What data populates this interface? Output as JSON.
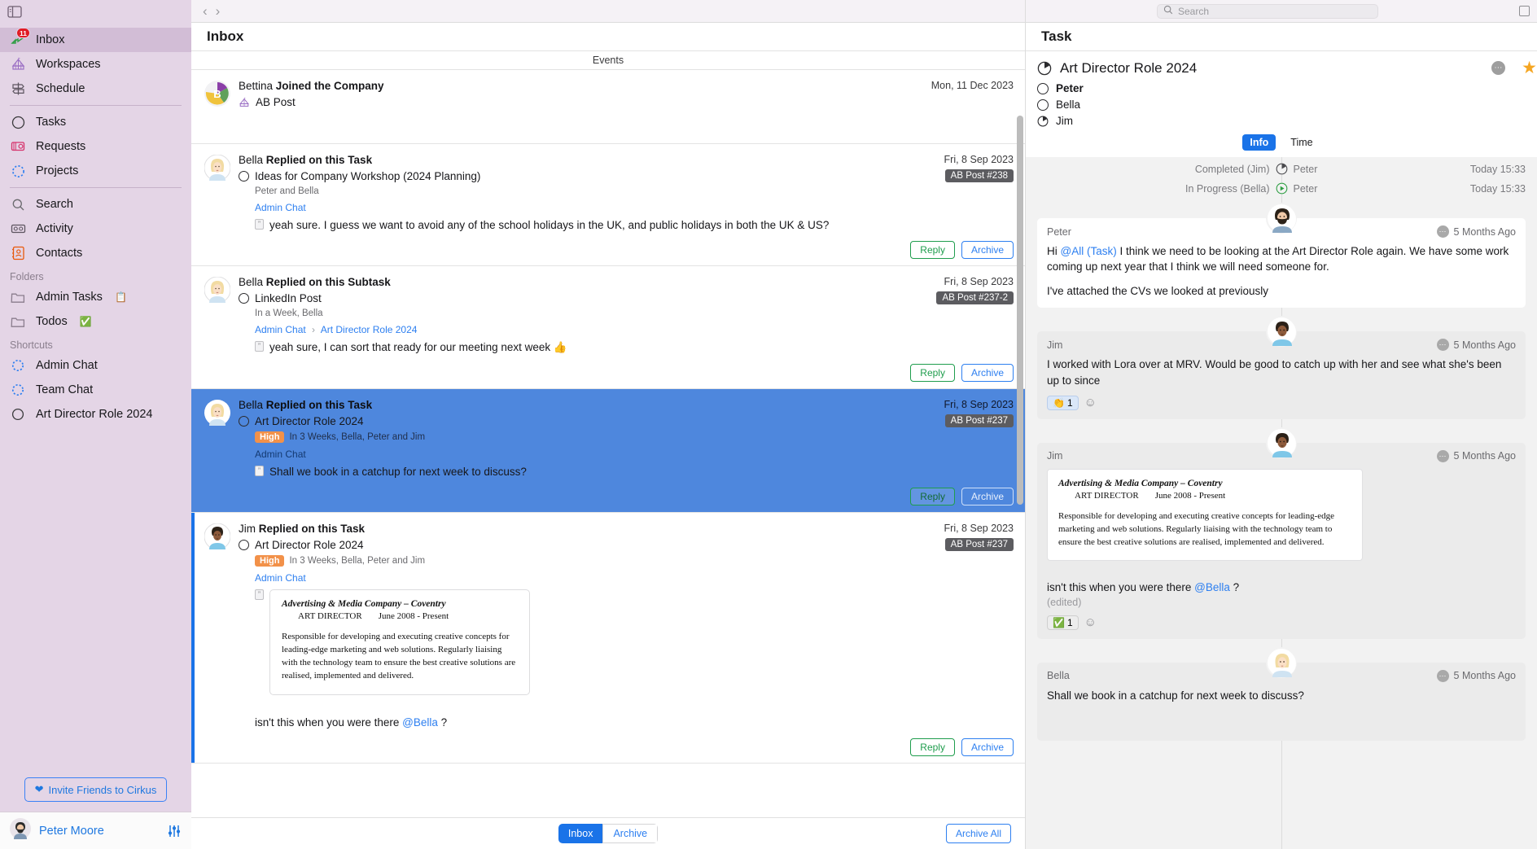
{
  "sidebar": {
    "panel_toggle": "panel-toggle",
    "items": [
      {
        "label": "Inbox",
        "icon": "inbox-icon",
        "badge": "11",
        "active": true
      },
      {
        "label": "Workspaces",
        "icon": "workspaces-icon"
      },
      {
        "label": "Schedule",
        "icon": "schedule-icon"
      }
    ],
    "items2": [
      {
        "label": "Tasks",
        "icon": "tasks-circle-icon"
      },
      {
        "label": "Requests",
        "icon": "requests-icon"
      },
      {
        "label": "Projects",
        "icon": "projects-dotted-circle-icon"
      }
    ],
    "items3": [
      {
        "label": "Search",
        "icon": "search-icon"
      },
      {
        "label": "Activity",
        "icon": "activity-icon"
      },
      {
        "label": "Contacts",
        "icon": "contacts-icon"
      }
    ],
    "folders_heading": "Folders",
    "folders": [
      {
        "label": "Admin Tasks",
        "emoji": "📋",
        "icon": "folder-icon"
      },
      {
        "label": "Todos",
        "emoji": "✅",
        "icon": "folder-icon"
      }
    ],
    "shortcuts_heading": "Shortcuts",
    "shortcuts": [
      {
        "label": "Admin Chat",
        "icon": "dotted-circle-icon"
      },
      {
        "label": "Team Chat",
        "icon": "dotted-circle-icon"
      },
      {
        "label": "Art Director Role 2024",
        "icon": "circle-icon"
      }
    ],
    "invite_label": "Invite Friends to Cirkus",
    "user_name": "Peter Moore"
  },
  "center": {
    "back_arrow": "‹",
    "forward_arrow": "›",
    "title": "Inbox",
    "events_label": "Events",
    "rows": [
      {
        "who_name": "Bettina",
        "who_action": "Joined the Company",
        "date": "Mon, 11 Dec 2023",
        "workspace": "AB Post",
        "kind": "event"
      },
      {
        "who_name": "Bella",
        "who_action": "Replied on this Task",
        "date": "Fri, 8 Sep 2023",
        "task": "Ideas for Company Workshop (2024 Planning)",
        "tag": "AB Post #238",
        "meta": "Peter and Bella",
        "channel": "Admin Chat",
        "message": "yeah sure.  I guess we want to avoid any of the school holidays in the UK, and public holidays in both the UK & US?",
        "reply_label": "Reply",
        "archive_label": "Archive"
      },
      {
        "who_name": "Bella",
        "who_action": "Replied on this Subtask",
        "date": "Fri, 8 Sep 2023",
        "task": "LinkedIn Post",
        "tag": "AB Post #237-2",
        "meta": "In a Week, Bella",
        "channel": "Admin Chat",
        "channel2": "Art Director Role 2024",
        "message": "yeah sure, I can sort that ready for our meeting next week 👍",
        "reply_label": "Reply",
        "archive_label": "Archive"
      },
      {
        "who_name": "Bella",
        "who_action": "Replied on this Task",
        "date": "Fri, 8 Sep 2023",
        "task": "Art Director Role 2024",
        "tag": "AB Post #237",
        "priority": "High",
        "meta": "In 3 Weeks, Bella, Peter and Jim",
        "channel": "Admin Chat",
        "message": "Shall we book in a catchup for next week to discuss?",
        "reply_label": "Reply",
        "archive_label": "Archive",
        "selected": true
      },
      {
        "who_name": "Jim",
        "who_action": "Replied on this Task",
        "date": "Fri, 8 Sep 2023",
        "task": "Art Director Role 2024",
        "tag": "AB Post #237",
        "priority": "High",
        "meta": "In 3 Weeks, Bella, Peter and Jim",
        "channel": "Admin Chat",
        "cv": {
          "company": "Advertising & Media Company – Coventry",
          "role": "ART DIRECTOR",
          "dates": "June 2008 - Present",
          "body": "Responsible for developing and executing creative concepts for leading-edge marketing and web solutions. Regularly liaising with the technology team to ensure the best creative solutions are realised, implemented and delivered."
        },
        "trailing": "isn't this when you were there ",
        "mention": "@Bella",
        "trailing_end": " ?",
        "reply_label": "Reply",
        "archive_label": "Archive"
      }
    ],
    "footer": {
      "inbox_label": "Inbox",
      "archive_label": "Archive",
      "archive_all_label": "Archive All"
    }
  },
  "right": {
    "search_placeholder": "Search",
    "search_value": "",
    "panel_title": "Task",
    "task_title": "Art Director Role 2024",
    "assignees": [
      {
        "name": "Peter",
        "state": "open",
        "bold": true
      },
      {
        "name": "Bella",
        "state": "open",
        "bold": false
      },
      {
        "name": "Jim",
        "state": "progress",
        "bold": false
      }
    ],
    "tabs": [
      {
        "label": "Info",
        "active": true
      },
      {
        "label": "Time",
        "active": false
      }
    ],
    "statuses": [
      {
        "label": "Completed (Jim)",
        "by": "Peter",
        "time": "Today 15:33",
        "icon": "clock-pie-icon"
      },
      {
        "label": "In Progress (Bella)",
        "by": "Peter",
        "time": "Today 15:33",
        "icon": "play-circle-icon"
      }
    ],
    "messages": [
      {
        "author": "Peter",
        "time": "5 Months Ago",
        "avatar": "peter-avatar",
        "white": true,
        "paras": [
          {
            "prefix": "Hi ",
            "mention": "@All (Task)",
            "suffix": " I think we need to be looking at the Art Director Role again.  We have some work coming up next year that I think we will need someone for."
          },
          {
            "prefix": "I've attached the CVs we looked at previously",
            "mention": "",
            "suffix": ""
          }
        ]
      },
      {
        "author": "Jim",
        "time": "5 Months Ago",
        "avatar": "jim-avatar",
        "white": false,
        "text": "I worked with Lora over at MRV.  Would be good to catch up with her and see what she's been up to since",
        "reactions": [
          {
            "emoji": "👏",
            "count": "1",
            "style": "blue"
          }
        ]
      },
      {
        "author": "Jim",
        "time": "5 Months Ago",
        "avatar": "jim-avatar",
        "white": false,
        "cv": {
          "company": "Advertising & Media Company – Coventry",
          "role": "ART DIRECTOR",
          "dates": "June 2008 - Present",
          "body": "Responsible for developing and executing creative concepts for leading-edge marketing and web solutions. Regularly liaising with the technology team to ensure the best creative solutions are realised, implemented and delivered."
        },
        "trailing": "isn't this when you were there ",
        "mention": "@Bella",
        "trailing_end": " ?",
        "edited": "(edited)",
        "reactions": [
          {
            "emoji": "✅",
            "count": "1",
            "style": "green"
          }
        ]
      },
      {
        "author": "Bella",
        "time": "5 Months Ago",
        "avatar": "bella-avatar",
        "white": false,
        "text": "Shall we book in a catchup for next week to discuss?"
      }
    ],
    "react_add": "☺"
  },
  "colors": {
    "sidebar_bg": "#e4d5e6",
    "selected_row": "#4e87dd",
    "accent_blue": "#1a73e8",
    "green": "#1f9d4d",
    "priority_high": "#f29149",
    "badge_red": "#e01b24",
    "star": "#f5a623"
  }
}
